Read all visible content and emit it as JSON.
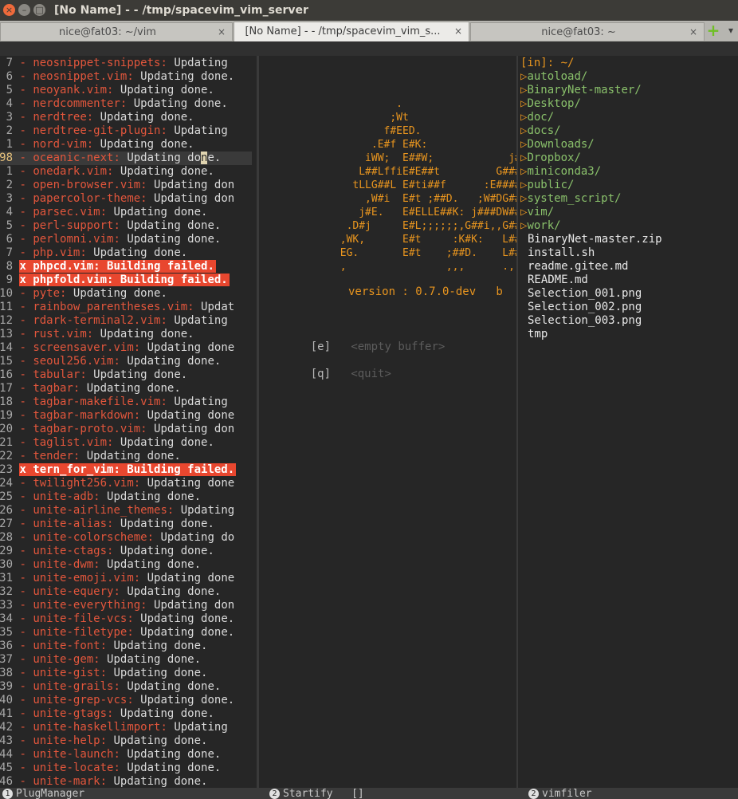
{
  "window": {
    "title": "[No Name] - - /tmp/spacevim_vim_server",
    "close_glyph": "×",
    "min_glyph": "–",
    "max_glyph": "□"
  },
  "tabs": [
    {
      "label": "nice@fat03: ~/vim",
      "close": "×",
      "active": false
    },
    {
      "label": "[No Name] - - /tmp/spacevim_vim_s...",
      "close": "×",
      "active": true
    },
    {
      "label": "nice@fat03: ~",
      "close": "×",
      "active": false
    }
  ],
  "new_tab_glyph": "+",
  "tab_menu_glyph": "▾",
  "plug_manager": {
    "lines": [
      {
        "num": "7",
        "mark": "-",
        "name": "neosnippet-snippets:",
        "status": " Updating"
      },
      {
        "num": "6",
        "mark": "-",
        "name": "neosnippet.vim:",
        "status": " Updating done."
      },
      {
        "num": "5",
        "mark": "-",
        "name": "neoyank.vim:",
        "status": " Updating done."
      },
      {
        "num": "4",
        "mark": "-",
        "name": "nerdcommenter:",
        "status": " Updating done."
      },
      {
        "num": "3",
        "mark": "-",
        "name": "nerdtree:",
        "status": " Updating done."
      },
      {
        "num": "2",
        "mark": "-",
        "name": "nerdtree-git-plugin:",
        "status": " Updating"
      },
      {
        "num": "1",
        "mark": "-",
        "name": "nord-vim:",
        "status": " Updating done."
      },
      {
        "num": "98",
        "mark": "-",
        "name": "oceanic-next:",
        "status_a": " Updating do",
        "cursor": "n",
        "status_b": "e.",
        "current": true
      },
      {
        "num": "1",
        "mark": "-",
        "name": "onedark.vim:",
        "status": " Updating done."
      },
      {
        "num": "2",
        "mark": "-",
        "name": "open-browser.vim:",
        "status": " Updating don"
      },
      {
        "num": "3",
        "mark": "-",
        "name": "papercolor-theme:",
        "status": " Updating don"
      },
      {
        "num": "4",
        "mark": "-",
        "name": "parsec.vim:",
        "status": " Updating done."
      },
      {
        "num": "5",
        "mark": "-",
        "name": "perl-support:",
        "status": " Updating done."
      },
      {
        "num": "6",
        "mark": "-",
        "name": "perlomni.vim:",
        "status": " Updating done."
      },
      {
        "num": "7",
        "mark": "-",
        "name": "php.vim:",
        "status": " Updating done."
      },
      {
        "num": "8",
        "fail": "x phpcd.vim: Building failed."
      },
      {
        "num": "9",
        "fail": "x phpfold.vim: Building failed."
      },
      {
        "num": "10",
        "mark": "-",
        "name": "pyte:",
        "status": " Updating done."
      },
      {
        "num": "11",
        "mark": "-",
        "name": "rainbow_parentheses.vim:",
        "status": " Updat"
      },
      {
        "num": "12",
        "mark": "-",
        "name": "rdark-terminal2.vim:",
        "status": " Updating"
      },
      {
        "num": "13",
        "mark": "-",
        "name": "rust.vim:",
        "status": " Updating done."
      },
      {
        "num": "14",
        "mark": "-",
        "name": "screensaver.vim:",
        "status": " Updating done"
      },
      {
        "num": "15",
        "mark": "-",
        "name": "seoul256.vim:",
        "status": " Updating done."
      },
      {
        "num": "16",
        "mark": "-",
        "name": "tabular:",
        "status": " Updating done."
      },
      {
        "num": "17",
        "mark": "-",
        "name": "tagbar:",
        "status": " Updating done."
      },
      {
        "num": "18",
        "mark": "-",
        "name": "tagbar-makefile.vim:",
        "status": " Updating"
      },
      {
        "num": "19",
        "mark": "-",
        "name": "tagbar-markdown:",
        "status": " Updating done"
      },
      {
        "num": "20",
        "mark": "-",
        "name": "tagbar-proto.vim:",
        "status": " Updating don"
      },
      {
        "num": "21",
        "mark": "-",
        "name": "taglist.vim:",
        "status": " Updating done."
      },
      {
        "num": "22",
        "mark": "-",
        "name": "tender:",
        "status": " Updating done."
      },
      {
        "num": "23",
        "fail": "x tern_for_vim: Building failed."
      },
      {
        "num": "24",
        "mark": "-",
        "name": "twilight256.vim:",
        "status": " Updating done"
      },
      {
        "num": "25",
        "mark": "-",
        "name": "unite-adb:",
        "status": " Updating done."
      },
      {
        "num": "26",
        "mark": "-",
        "name": "unite-airline_themes:",
        "status": " Updating"
      },
      {
        "num": "27",
        "mark": "-",
        "name": "unite-alias:",
        "status": " Updating done."
      },
      {
        "num": "28",
        "mark": "-",
        "name": "unite-colorscheme:",
        "status": " Updating do"
      },
      {
        "num": "29",
        "mark": "-",
        "name": "unite-ctags:",
        "status": " Updating done."
      },
      {
        "num": "30",
        "mark": "-",
        "name": "unite-dwm:",
        "status": " Updating done."
      },
      {
        "num": "31",
        "mark": "-",
        "name": "unite-emoji.vim:",
        "status": " Updating done"
      },
      {
        "num": "32",
        "mark": "-",
        "name": "unite-equery:",
        "status": " Updating done."
      },
      {
        "num": "33",
        "mark": "-",
        "name": "unite-everything:",
        "status": " Updating don"
      },
      {
        "num": "34",
        "mark": "-",
        "name": "unite-file-vcs:",
        "status": " Updating done."
      },
      {
        "num": "35",
        "mark": "-",
        "name": "unite-filetype:",
        "status": " Updating done."
      },
      {
        "num": "36",
        "mark": "-",
        "name": "unite-font:",
        "status": " Updating done."
      },
      {
        "num": "37",
        "mark": "-",
        "name": "unite-gem:",
        "status": " Updating done."
      },
      {
        "num": "38",
        "mark": "-",
        "name": "unite-gist:",
        "status": " Updating done."
      },
      {
        "num": "39",
        "mark": "-",
        "name": "unite-grails:",
        "status": " Updating done."
      },
      {
        "num": "40",
        "mark": "-",
        "name": "unite-grep-vcs:",
        "status": " Updating done."
      },
      {
        "num": "41",
        "mark": "-",
        "name": "unite-gtags:",
        "status": " Updating done."
      },
      {
        "num": "42",
        "mark": "-",
        "name": "unite-haskellimport:",
        "status": " Updating"
      },
      {
        "num": "43",
        "mark": "-",
        "name": "unite-help:",
        "status": " Updating done."
      },
      {
        "num": "44",
        "mark": "-",
        "name": "unite-launch:",
        "status": " Updating done."
      },
      {
        "num": "45",
        "mark": "-",
        "name": "unite-locate:",
        "status": " Updating done."
      },
      {
        "num": "46",
        "mark": "-",
        "name": "unite-mark:",
        "status": " Updating done."
      }
    ]
  },
  "startify": {
    "ascii_art": [
      "                      .",
      "                     ;Wt",
      "                    f#EED.               .",
      "                  .E#f E#K:              ;W",
      "                 iWW;  E##W;            j##",
      "                L##LffiE#E##t         G###",
      "               tLLG##L E#ti##f      :E####",
      "                 ,W#i  E#t ;##D.   ;W#DG##",
      "                j#E.   E#ELLE##K: j###DW##",
      "              .D#j     E#L;;;;;;,G##i,,G##",
      "             ,WK,      E#t     :K#K:   L##",
      "             EG.       E#t    ;##D.    L##",
      "             ,                ,,,      .,,"
    ],
    "version": "version : 0.7.0-dev   b",
    "menu": [
      {
        "key": "[e]",
        "label": "<empty buffer>"
      },
      {
        "key": "[q]",
        "label": "<quit>"
      }
    ]
  },
  "vimfiler": {
    "header": "[in]: ~/",
    "dirs": [
      "autoload/",
      "BinaryNet-master/",
      "Desktop/",
      "doc/",
      "docs/",
      "Downloads/",
      "Dropbox/",
      "miniconda3/",
      "public/",
      "system_script/",
      "vim/",
      "work/"
    ],
    "dir_icon": "▷",
    "files": [
      "BinaryNet-master.zip",
      "install.sh",
      "readme.gitee.md",
      "README.md",
      "Selection_001.png",
      "Selection_002.png",
      "Selection_003.png",
      "tmp"
    ]
  },
  "statusline": {
    "left": {
      "num": "1",
      "label": "PlugManager"
    },
    "mid": {
      "num": "2",
      "label": "Startify",
      "extra": "[]"
    },
    "right": {
      "num": "2",
      "label": "vimfiler"
    }
  },
  "colors": {
    "plugin_name": "#e2563c",
    "failed_bg": "#e8472f",
    "startify_logo": "#e8951f",
    "directory": "#8ac16b",
    "background": "#262626"
  }
}
